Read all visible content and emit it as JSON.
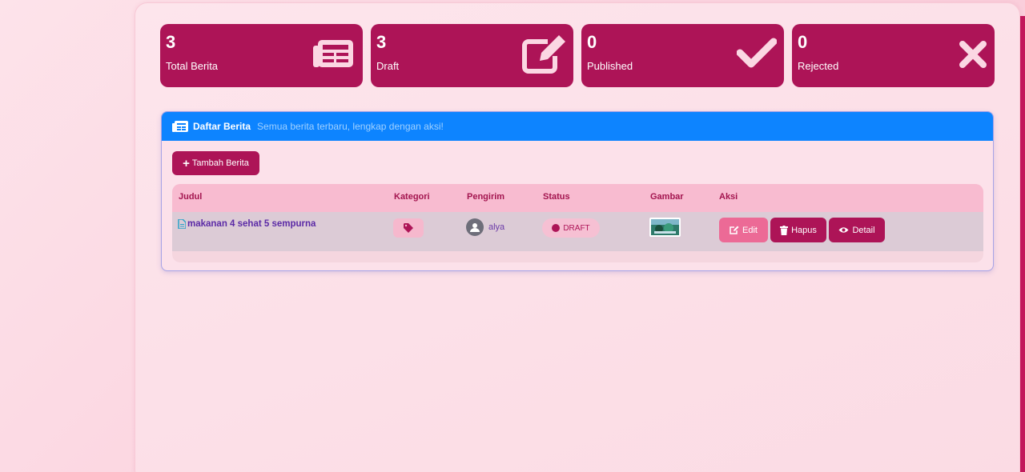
{
  "stats": [
    {
      "value": "3",
      "label": "Total Berita",
      "icon": "newspaper-icon"
    },
    {
      "value": "3",
      "label": "Draft",
      "icon": "edit-icon"
    },
    {
      "value": "0",
      "label": "Published",
      "icon": "check-icon"
    },
    {
      "value": "0",
      "label": "Rejected",
      "icon": "x-icon"
    }
  ],
  "news_list": {
    "title": "Daftar Berita",
    "subtitle": "Semua berita terbaru, lengkap dengan aksi!",
    "add_button": "Tambah Berita",
    "columns": [
      "Judul",
      "Kategori",
      "Pengirim",
      "Status",
      "Gambar",
      "Aksi"
    ],
    "rows": [
      {
        "title": "makanan 4 sehat 5 sempurna",
        "category_icon": "tag-icon",
        "sender": "alya",
        "status": "DRAFT",
        "actions": [
          "Edit",
          "Hapus",
          "Detail"
        ]
      }
    ]
  },
  "colors": {
    "primary": "#ad1457",
    "header_blue": "#0d84ff",
    "edit_pink": "#ec6a96",
    "table_header": "#f8bbd0"
  }
}
